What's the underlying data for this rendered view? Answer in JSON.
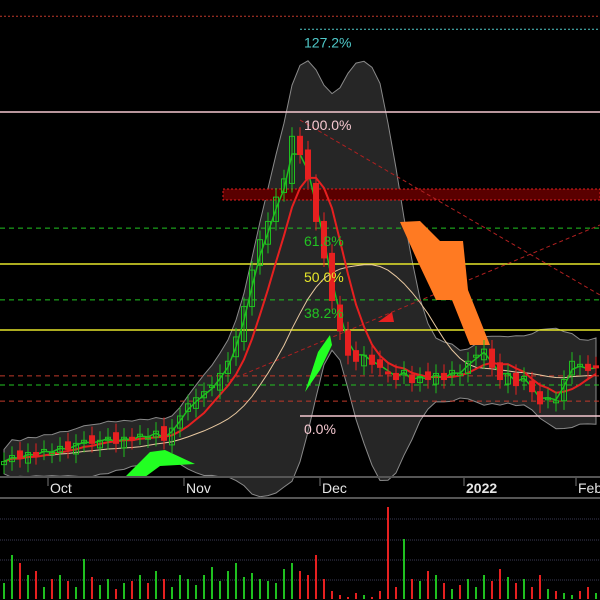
{
  "chart_data": {
    "type": "candlestick",
    "title": "",
    "price_units": "fib-percent of swing (0% = swing low, 100% = swing high)",
    "ylim": [
      -20,
      140
    ],
    "x_tick_labels": [
      "Oct",
      "Nov",
      "Dec",
      "2022",
      "Feb"
    ],
    "x_tick_bar_index": [
      7,
      24,
      41,
      59,
      73
    ],
    "fib_levels": [
      {
        "label": "127.2%",
        "value": 127.2,
        "color": "#4fc9c9",
        "style": "dotted"
      },
      {
        "label": "100.0%",
        "value": 100.0,
        "color": "#f5c8d0",
        "style": "solid"
      },
      {
        "label": "61.8%",
        "value": 61.8,
        "color": "#22c322",
        "style": "dashed"
      },
      {
        "label": "50.0%",
        "value": 50.0,
        "color": "#e6e62a",
        "style": "solid"
      },
      {
        "label": "38.2%",
        "value": 38.2,
        "color": "#22c322",
        "style": "dashed"
      },
      {
        "label": "0.0%",
        "value": 0.0,
        "color": "#f5c8d0",
        "style": "solid"
      }
    ],
    "other_levels": [
      {
        "value": 131.5,
        "color": "#c0392b",
        "style": "dotted"
      },
      {
        "value": 28.3,
        "color": "#e6e62a",
        "style": "solid"
      },
      {
        "value": 13.2,
        "color": "#c0392b",
        "style": "dashed"
      },
      {
        "value": 10.2,
        "color": "#22c322",
        "style": "dashed"
      },
      {
        "value": 4.9,
        "color": "#c0392b",
        "style": "dashed"
      }
    ],
    "closes": [
      -15,
      -13,
      -14,
      -12,
      -13,
      -11,
      -12,
      -10,
      -11,
      -9,
      -8,
      -9,
      -8,
      -7,
      -9,
      -7,
      -8,
      -6,
      -7,
      -5,
      -8,
      -4,
      0,
      4,
      6,
      8,
      10,
      14,
      18,
      26,
      36,
      48,
      58,
      64,
      72,
      78,
      92,
      86,
      78,
      64,
      52,
      38,
      28,
      20,
      18,
      20,
      17,
      16,
      14,
      12,
      15,
      11,
      13,
      12,
      14,
      12,
      15,
      14,
      18,
      20,
      22,
      16,
      12,
      14,
      10,
      13,
      8,
      4,
      6,
      5,
      12,
      18,
      17,
      15,
      16
    ],
    "volume": [
      8,
      22,
      18,
      12,
      14,
      6,
      10,
      12,
      9,
      6,
      20,
      11,
      7,
      10,
      5,
      8,
      9,
      12,
      8,
      14,
      10,
      6,
      12,
      10,
      7,
      12,
      16,
      9,
      14,
      18,
      11,
      13,
      10,
      9,
      8,
      15,
      18,
      14,
      12,
      22,
      10,
      4,
      2,
      1,
      3,
      2,
      1,
      4,
      46,
      6,
      30,
      10,
      9,
      14,
      12,
      8,
      5,
      7,
      10,
      6,
      12,
      9,
      15,
      11,
      8,
      10,
      6,
      12,
      5,
      4,
      3,
      2,
      4,
      6,
      3
    ],
    "volume_colors_by_candle": true,
    "series": [
      {
        "name": "Fast MA",
        "color": "#1fbf1f"
      },
      {
        "name": "Mid MA",
        "color": "#e62020"
      },
      {
        "name": "Slow MA",
        "color": "#e8c8a0"
      },
      {
        "name": "Bollinger Bands",
        "color": "#9a9a9a"
      }
    ],
    "colors": {
      "up": "#1fbf1f",
      "down": "#e62020",
      "orange_zone": "#ff7a22",
      "green_zone": "#22ff22",
      "band_fill": "#262626"
    },
    "grid": false,
    "legend": "none"
  }
}
